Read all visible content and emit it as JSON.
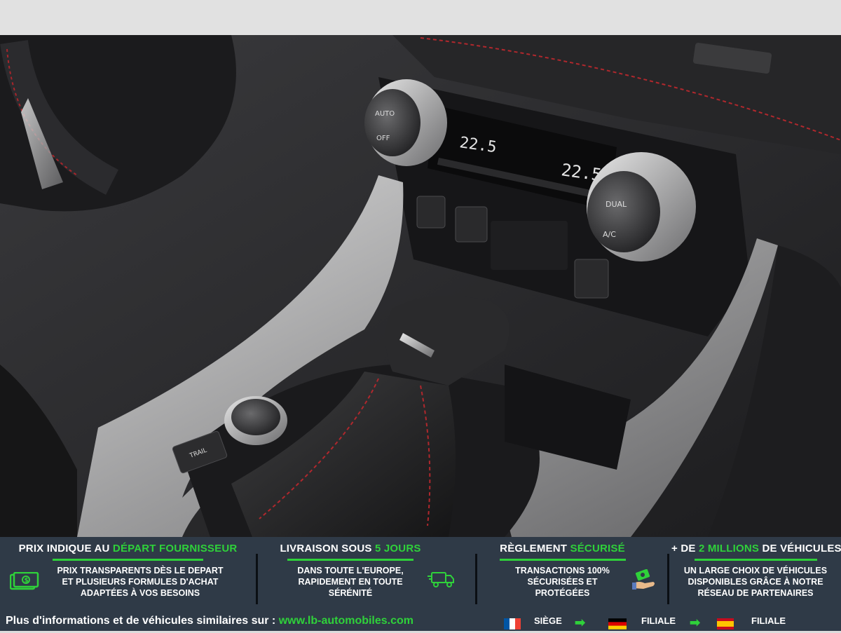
{
  "banner": {
    "col1": {
      "title_prefix": "PRIX INDIQUE AU ",
      "title_accent": "DÉPART FOURNISSEUR",
      "body": "PRIX TRANSPARENTS DÈS LE DEPART ET PLUSIEURS FORMULES D'ACHAT ADAPTÉES À VOS BESOINS",
      "icon": "money-icon"
    },
    "col2": {
      "title_prefix": "LIVRAISON SOUS ",
      "title_accent": "5 JOURS",
      "body": "DANS TOUTE L'EUROPE, RAPIDEMENT EN TOUTE SÉRÉNITÉ",
      "icon": "truck-icon"
    },
    "col3": {
      "title_prefix": "RÈGLEMENT ",
      "title_accent": "SÉCURISÉ",
      "body": "TRANSACTIONS 100% SÉCURISÉES ET PROTÉGÉES",
      "icon": "payment-hand-icon"
    },
    "col4": {
      "title_prefix": "+ DE ",
      "title_accent": "2 MILLIONS",
      "title_suffix": " DE VÉHICULES",
      "body": "UN LARGE CHOIX DE VÉHICULES DISPONIBLES GRÂCE À NOTRE RÉSEAU DE PARTENAIRES"
    }
  },
  "footer": {
    "text": "Plus d'informations et de véhicules similaires sur : ",
    "link": "www.lb-automobiles.com",
    "locations": [
      {
        "flag": "france-flag-icon",
        "label": "SIÈGE"
      },
      {
        "flag": "germany-flag-icon",
        "label": "FILIALE"
      },
      {
        "flag": "spain-flag-icon",
        "label": "FILIALE"
      }
    ]
  },
  "photo": {
    "climate_left_temp": "22.5",
    "climate_right_temp": "22.5",
    "left_knob_labels": [
      "AUTO",
      "OFF"
    ],
    "right_knob_labels": [
      "DUAL",
      "A/C"
    ],
    "drive_mode_label": "TRAIL"
  },
  "colors": {
    "banner_bg": "#2f3a47",
    "accent": "#2fd13a"
  }
}
